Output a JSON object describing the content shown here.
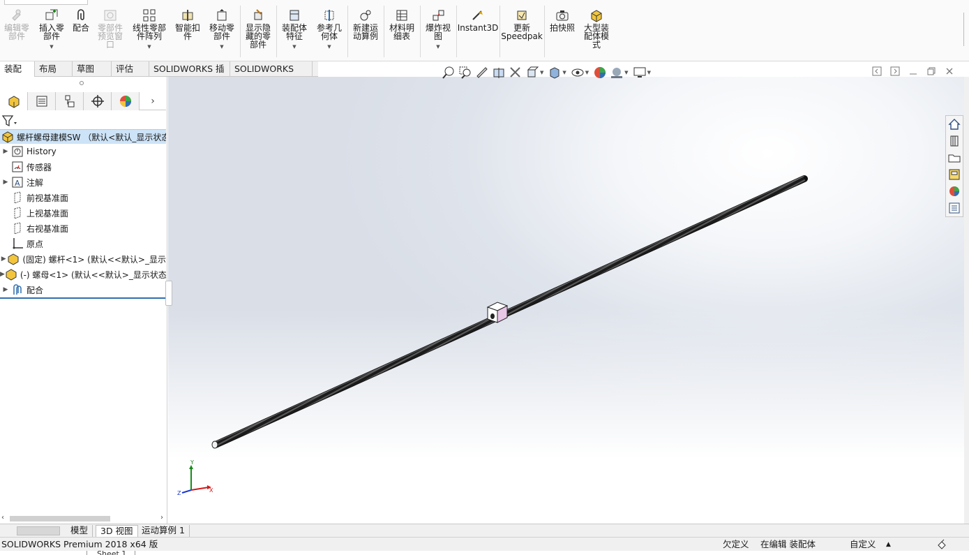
{
  "ribbon": {
    "buttons": [
      {
        "label": "编辑零\n部件",
        "icon": "edit-component-icon",
        "disabled": true
      },
      {
        "label": "插入零\n部件",
        "icon": "insert-component-icon"
      },
      {
        "label": "配合",
        "icon": "mate-icon"
      },
      {
        "label": "零部件\n预览窗\n口",
        "icon": "component-preview-icon",
        "disabled": true
      },
      {
        "label": "线性零部\n件阵列",
        "icon": "linear-pattern-icon"
      },
      {
        "label": "智能扣\n件",
        "icon": "smart-fasteners-icon"
      },
      {
        "label": "移动零\n部件",
        "icon": "move-component-icon"
      },
      {
        "label": "显示隐\n藏的零\n部件",
        "icon": "show-hidden-icon"
      },
      {
        "label": "装配体\n特征",
        "icon": "assembly-features-icon"
      },
      {
        "label": "参考几\n何体",
        "icon": "reference-geometry-icon"
      },
      {
        "label": "新建运\n动算例",
        "icon": "motion-study-icon"
      },
      {
        "label": "材料明\n细表",
        "icon": "bom-icon"
      },
      {
        "label": "爆炸视\n图",
        "icon": "exploded-view-icon"
      },
      {
        "label": "Instant3D",
        "icon": "instant3d-icon"
      },
      {
        "label": "更新\nSpeedpak",
        "icon": "speedpak-icon"
      },
      {
        "label": "拍快照",
        "icon": "snapshot-icon"
      },
      {
        "label": "大型装\n配体模\n式",
        "icon": "large-assembly-icon"
      }
    ]
  },
  "command_tabs": [
    "装配体",
    "布局",
    "草图",
    "评估",
    "SOLIDWORKS 插件",
    "SOLIDWORKS MBD"
  ],
  "tree": {
    "root": "螺杆螺母建模SW （默认<默认_显示状态-",
    "items": [
      {
        "label": "History",
        "icon": "history-icon"
      },
      {
        "label": "传感器",
        "icon": "sensor-icon"
      },
      {
        "label": "注解",
        "icon": "annotations-icon"
      },
      {
        "label": "前视基准面",
        "icon": "plane-icon"
      },
      {
        "label": "上视基准面",
        "icon": "plane-icon"
      },
      {
        "label": "右视基准面",
        "icon": "plane-icon"
      },
      {
        "label": "原点",
        "icon": "origin-icon"
      },
      {
        "label": "(固定) 螺杆<1> (默认<<默认>_显示",
        "icon": "part-icon"
      },
      {
        "label": "(-) 螺母<1> (默认<<默认>_显示状态",
        "icon": "part-icon"
      },
      {
        "label": "配合",
        "icon": "mates-folder-icon"
      }
    ]
  },
  "triad": {
    "x": "X",
    "y": "Y",
    "z": "Z"
  },
  "bottom_tabs": [
    "模型",
    "3D 视图",
    "运动算例 1"
  ],
  "status": {
    "app": "SOLIDWORKS Premium 2018 x64 版",
    "defined": "欠定义",
    "editing": "在编辑 装配体",
    "units": "自定义",
    "units_arrow": "▲",
    "sheet": "Sheet 1"
  },
  "colors": {
    "accent": "#2f6fb0",
    "tree_selection": "#cde3f7",
    "nut_face": "#e8c6e6",
    "axis_x": "#d11a1a",
    "axis_y": "#1a8a1a",
    "axis_z": "#1a3ad1"
  }
}
